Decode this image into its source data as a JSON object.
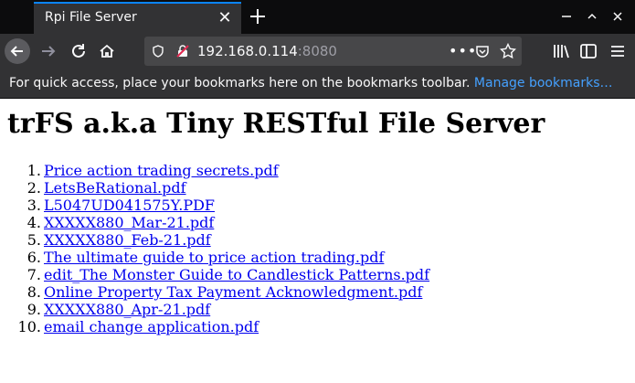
{
  "browser": {
    "tab_title": "Rpi File Server",
    "url_host": "192.168.0.114",
    "url_port": ":8080",
    "bookmarks_prompt": "For quick access, place your bookmarks here on the bookmarks toolbar.",
    "bookmarks_link": "Manage bookmarks…",
    "theme": {
      "tabbar_bg": "#0c0c0d",
      "toolbar_bg": "#323234",
      "accent": "#0a84ff",
      "link": "#45a1ff"
    }
  },
  "page": {
    "heading": "trFS a.k.a Tiny RESTful File Server",
    "files": [
      {
        "num": "1.",
        "name": "Price action trading secrets.pdf"
      },
      {
        "num": "2.",
        "name": "LetsBeRational.pdf"
      },
      {
        "num": "3.",
        "name": "L5047UD041575Y.PDF"
      },
      {
        "num": "4.",
        "name": "XXXXX880_Mar-21.pdf"
      },
      {
        "num": "5.",
        "name": "XXXXX880_Feb-21.pdf"
      },
      {
        "num": "6.",
        "name": "The ultimate guide to price action trading.pdf"
      },
      {
        "num": "7.",
        "name": "edit_The Monster Guide to Candlestick Patterns.pdf"
      },
      {
        "num": "8.",
        "name": "Online Property Tax Payment Acknowledgment.pdf"
      },
      {
        "num": "9.",
        "name": "XXXXX880_Apr-21.pdf"
      },
      {
        "num": "10.",
        "name": "email change application.pdf"
      }
    ]
  }
}
